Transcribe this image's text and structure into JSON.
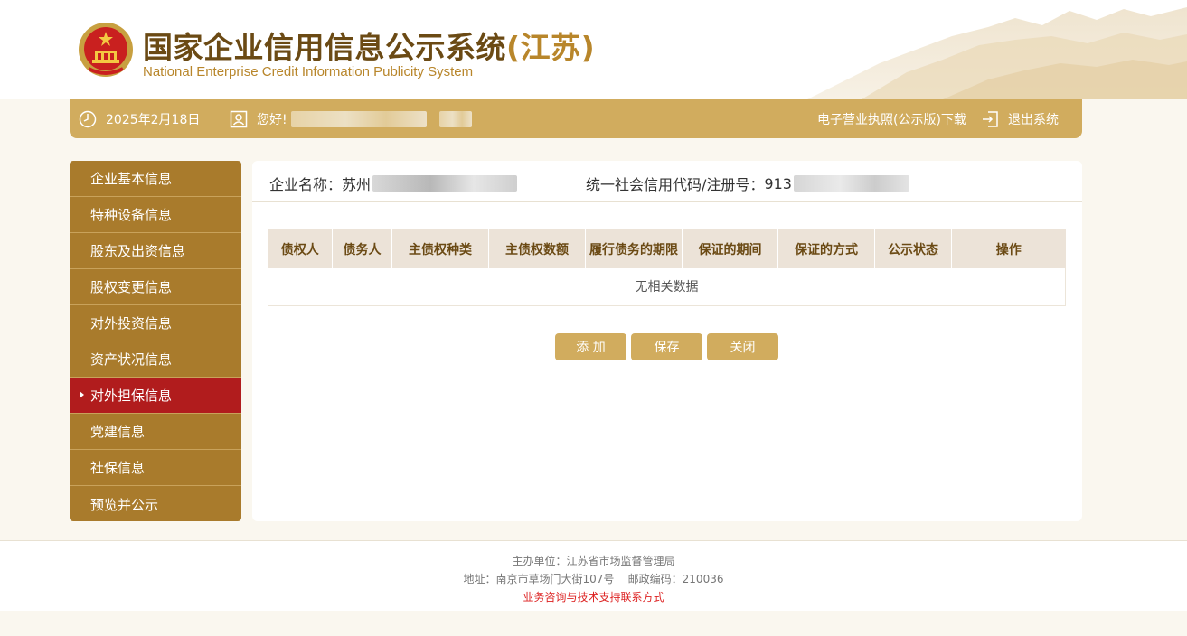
{
  "header": {
    "title": "国家企业信用信息公示系统",
    "region": "(江苏)",
    "subtitle": "National Enterprise Credit Information Publicity System"
  },
  "topbar": {
    "date": "2025年2月18日",
    "greeting": "您好!",
    "download_link": "电子营业执照(公示版)下载",
    "logout": "退出系统"
  },
  "sidebar": {
    "items": [
      {
        "label": "企业基本信息"
      },
      {
        "label": "特种设备信息"
      },
      {
        "label": "股东及出资信息"
      },
      {
        "label": "股权变更信息"
      },
      {
        "label": "对外投资信息"
      },
      {
        "label": "资产状况信息"
      },
      {
        "label": "对外担保信息"
      },
      {
        "label": "党建信息"
      },
      {
        "label": "社保信息"
      },
      {
        "label": "预览并公示"
      }
    ],
    "active_index": 6
  },
  "company": {
    "name_label": "企业名称：",
    "name_value": "苏州",
    "code_label": "统一社会信用代码/注册号：",
    "code_value": "913"
  },
  "table": {
    "columns": [
      "债权人",
      "债务人",
      "主债权种类",
      "主债权数额",
      "履行债务的期限",
      "保证的期间",
      "保证的方式",
      "公示状态",
      "操作"
    ],
    "empty_text": "无相关数据"
  },
  "buttons": {
    "add": "添 加",
    "save": "保存",
    "close": "关闭"
  },
  "footer": {
    "sponsor": "主办单位：江苏省市场监督管理局",
    "address": "地址：南京市草场门大街107号    邮政编码：210036",
    "support": "业务咨询与技术支持联系方式"
  },
  "colors": {
    "gold": "#d1ac5e",
    "sidebar": "#a97b2c",
    "active": "#b11c1d",
    "title": "#6b4a14"
  }
}
